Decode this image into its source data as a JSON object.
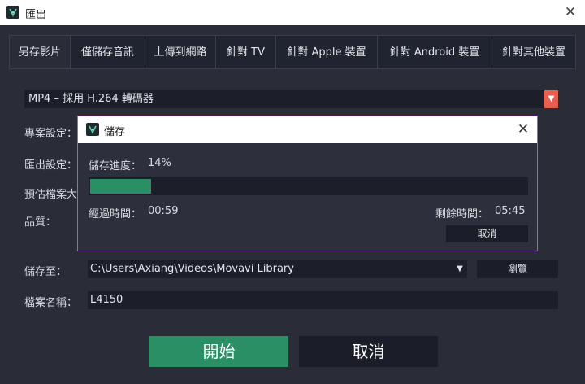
{
  "window": {
    "title": "匯出",
    "close_glyph": "✕",
    "icon": "movavi-app-icon"
  },
  "tabs": [
    {
      "label": "另存影片",
      "active": true
    },
    {
      "label": "僅儲存音訊",
      "active": false
    },
    {
      "label": "上傳到網路",
      "active": false
    },
    {
      "label": "針對 TV",
      "active": false
    },
    {
      "label": "針對 Apple 裝置",
      "active": false
    },
    {
      "label": "針對 Android 裝置",
      "active": false
    },
    {
      "label": "針對其他裝置",
      "active": false
    }
  ],
  "format": {
    "value": "MP4 – 採用 H.264 轉碼器",
    "arrow": "▼"
  },
  "labels": {
    "project_settings": "專案設定：",
    "export_settings": "匯出設定：",
    "estimated_size": "預估檔案大",
    "quality": "品質：",
    "save_to": "儲存至：",
    "file_name": "檔案名稱："
  },
  "save_path": {
    "value": "C:\\Users\\Axiang\\Videos\\Movavi Library",
    "arrow": "▼"
  },
  "browse_label": "瀏覽",
  "file_name_value": "L4150",
  "buttons": {
    "start": "開始",
    "cancel": "取消"
  },
  "colors": {
    "accent_green": "#2b8f66",
    "dropdown_orange": "#e8604d",
    "dialog_border": "#9d62c4"
  },
  "dialog": {
    "title": "儲存",
    "close_glyph": "✕",
    "progress_label": "儲存進度：",
    "progress_value": "14%",
    "progress": 0.14,
    "elapsed_label": "經過時間：",
    "elapsed_value": "00:59",
    "remaining_label": "剩餘時間：",
    "remaining_value": "05:45",
    "cancel_label": "取消"
  }
}
